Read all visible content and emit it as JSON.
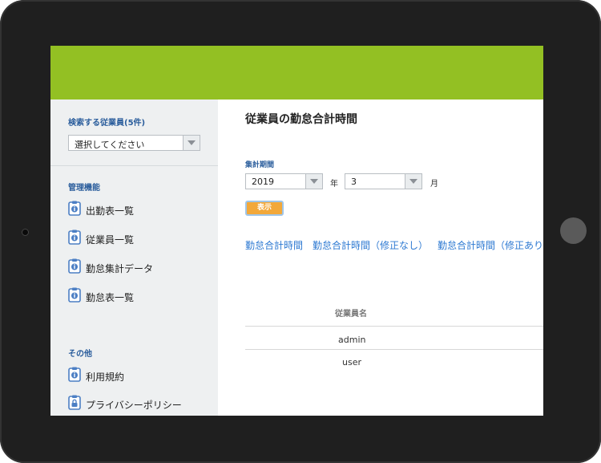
{
  "sidebar": {
    "search_heading": "検索する従業員(5件)",
    "employee_select": "選択してください",
    "admin_heading": "管理機能",
    "admin_items": [
      "出勤表一覧",
      "従業員一覧",
      "勤怠集計データ",
      "勤怠表一覧"
    ],
    "other_heading": "その他",
    "other_items": [
      "利用規約",
      "プライバシーポリシー"
    ]
  },
  "main": {
    "title": "従業員の勤怠合計時間",
    "period_label": "集計期間",
    "year_value": "2019",
    "year_unit": "年",
    "month_value": "3",
    "month_unit": "月",
    "show_button": "表示",
    "tabs": [
      "勤怠合計時間",
      "勤怠合計時間（修正なし）",
      "勤怠合計時間（修正あり"
    ],
    "table": {
      "header": "従業員名",
      "rows": [
        "admin",
        "user"
      ]
    }
  },
  "colors": {
    "topbar": "#93c023",
    "sidebar": "#eef0f1",
    "heading_blue": "#2a5d9c",
    "link_blue": "#2d79d2",
    "button_orange": "#f2a83a",
    "device": "#1f1f1f"
  }
}
